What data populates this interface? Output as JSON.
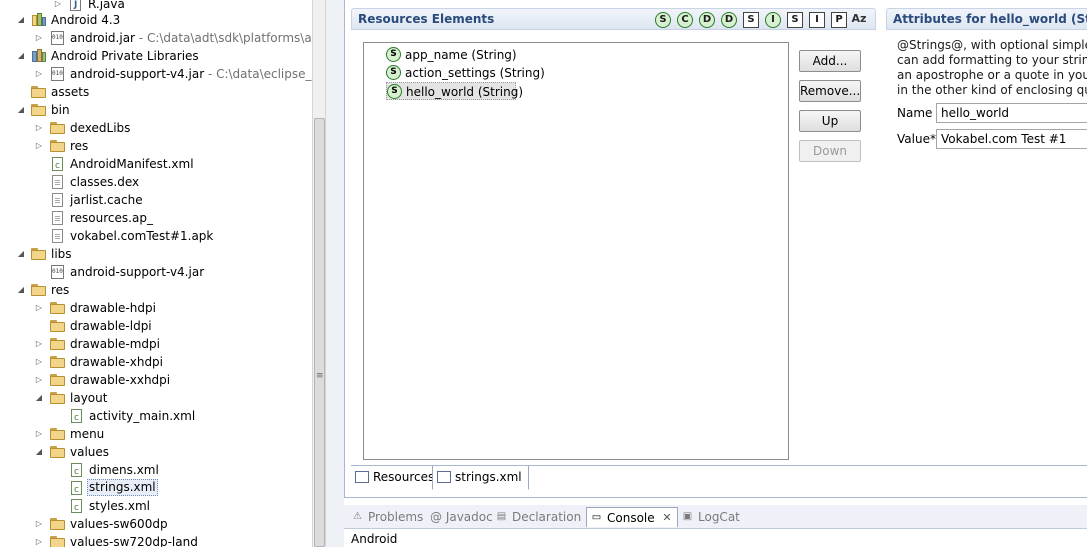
{
  "explorer": {
    "rows": [
      {
        "label": "R.java",
        "sub": ""
      },
      {
        "label": "Android 4.3",
        "sub": ""
      },
      {
        "label": "android.jar",
        "sub": " - C:\\data\\adt\\sdk\\platforms\\andro"
      },
      {
        "label": "Android Private Libraries",
        "sub": ""
      },
      {
        "label": "android-support-v4.jar",
        "sub": " - C:\\data\\eclipse_work"
      },
      {
        "label": "assets",
        "sub": ""
      },
      {
        "label": "bin",
        "sub": ""
      },
      {
        "label": "dexedLibs",
        "sub": ""
      },
      {
        "label": "res",
        "sub": ""
      },
      {
        "label": "AndroidManifest.xml",
        "sub": ""
      },
      {
        "label": "classes.dex",
        "sub": ""
      },
      {
        "label": "jarlist.cache",
        "sub": ""
      },
      {
        "label": "resources.ap_",
        "sub": ""
      },
      {
        "label": "vokabel.comTest#1.apk",
        "sub": ""
      },
      {
        "label": "libs",
        "sub": ""
      },
      {
        "label": "android-support-v4.jar",
        "sub": ""
      },
      {
        "label": "res",
        "sub": ""
      },
      {
        "label": "drawable-hdpi",
        "sub": ""
      },
      {
        "label": "drawable-ldpi",
        "sub": ""
      },
      {
        "label": "drawable-mdpi",
        "sub": ""
      },
      {
        "label": "drawable-xhdpi",
        "sub": ""
      },
      {
        "label": "drawable-xxhdpi",
        "sub": ""
      },
      {
        "label": "layout",
        "sub": ""
      },
      {
        "label": "activity_main.xml",
        "sub": ""
      },
      {
        "label": "menu",
        "sub": ""
      },
      {
        "label": "values",
        "sub": ""
      },
      {
        "label": "dimens.xml",
        "sub": ""
      },
      {
        "label": "strings.xml",
        "sub": ""
      },
      {
        "label": "styles.xml",
        "sub": ""
      },
      {
        "label": "values-sw600dp",
        "sub": ""
      },
      {
        "label": "values-sw720dp-land",
        "sub": ""
      }
    ]
  },
  "resources": {
    "title": "Resources Elements",
    "toolbar": [
      "S",
      "C",
      "D",
      "D",
      "S",
      "I",
      "S",
      "I",
      "P",
      "Az"
    ],
    "items": [
      {
        "icon": "S",
        "label": "app_name (String)"
      },
      {
        "icon": "S",
        "label": "action_settings (String)"
      },
      {
        "icon": "S",
        "label": "hello_world (String)"
      }
    ],
    "buttons": {
      "add": "Add...",
      "remove": "Remove...",
      "up": "Up",
      "down": "Down"
    }
  },
  "attributes": {
    "title": "Attributes for hello_world (String)",
    "description": [
      "@Strings@, with optional simple for",
      "can add formatting to your string by",
      "an apostrophe or a quote in your str",
      "in the other kind of enclosing quote"
    ],
    "name_label": "Name",
    "name_value": "hello_world",
    "value_label": "Value*",
    "value_value": "Vokabel.com Test #1"
  },
  "editor_tabs": {
    "resources": "Resources",
    "strings_xml": "strings.xml"
  },
  "console": {
    "tabs": {
      "problems": "Problems",
      "javadoc": "@ Javadoc",
      "declaration": "Declaration",
      "console": "Console",
      "logcat": "LogCat"
    },
    "content": "Android"
  }
}
